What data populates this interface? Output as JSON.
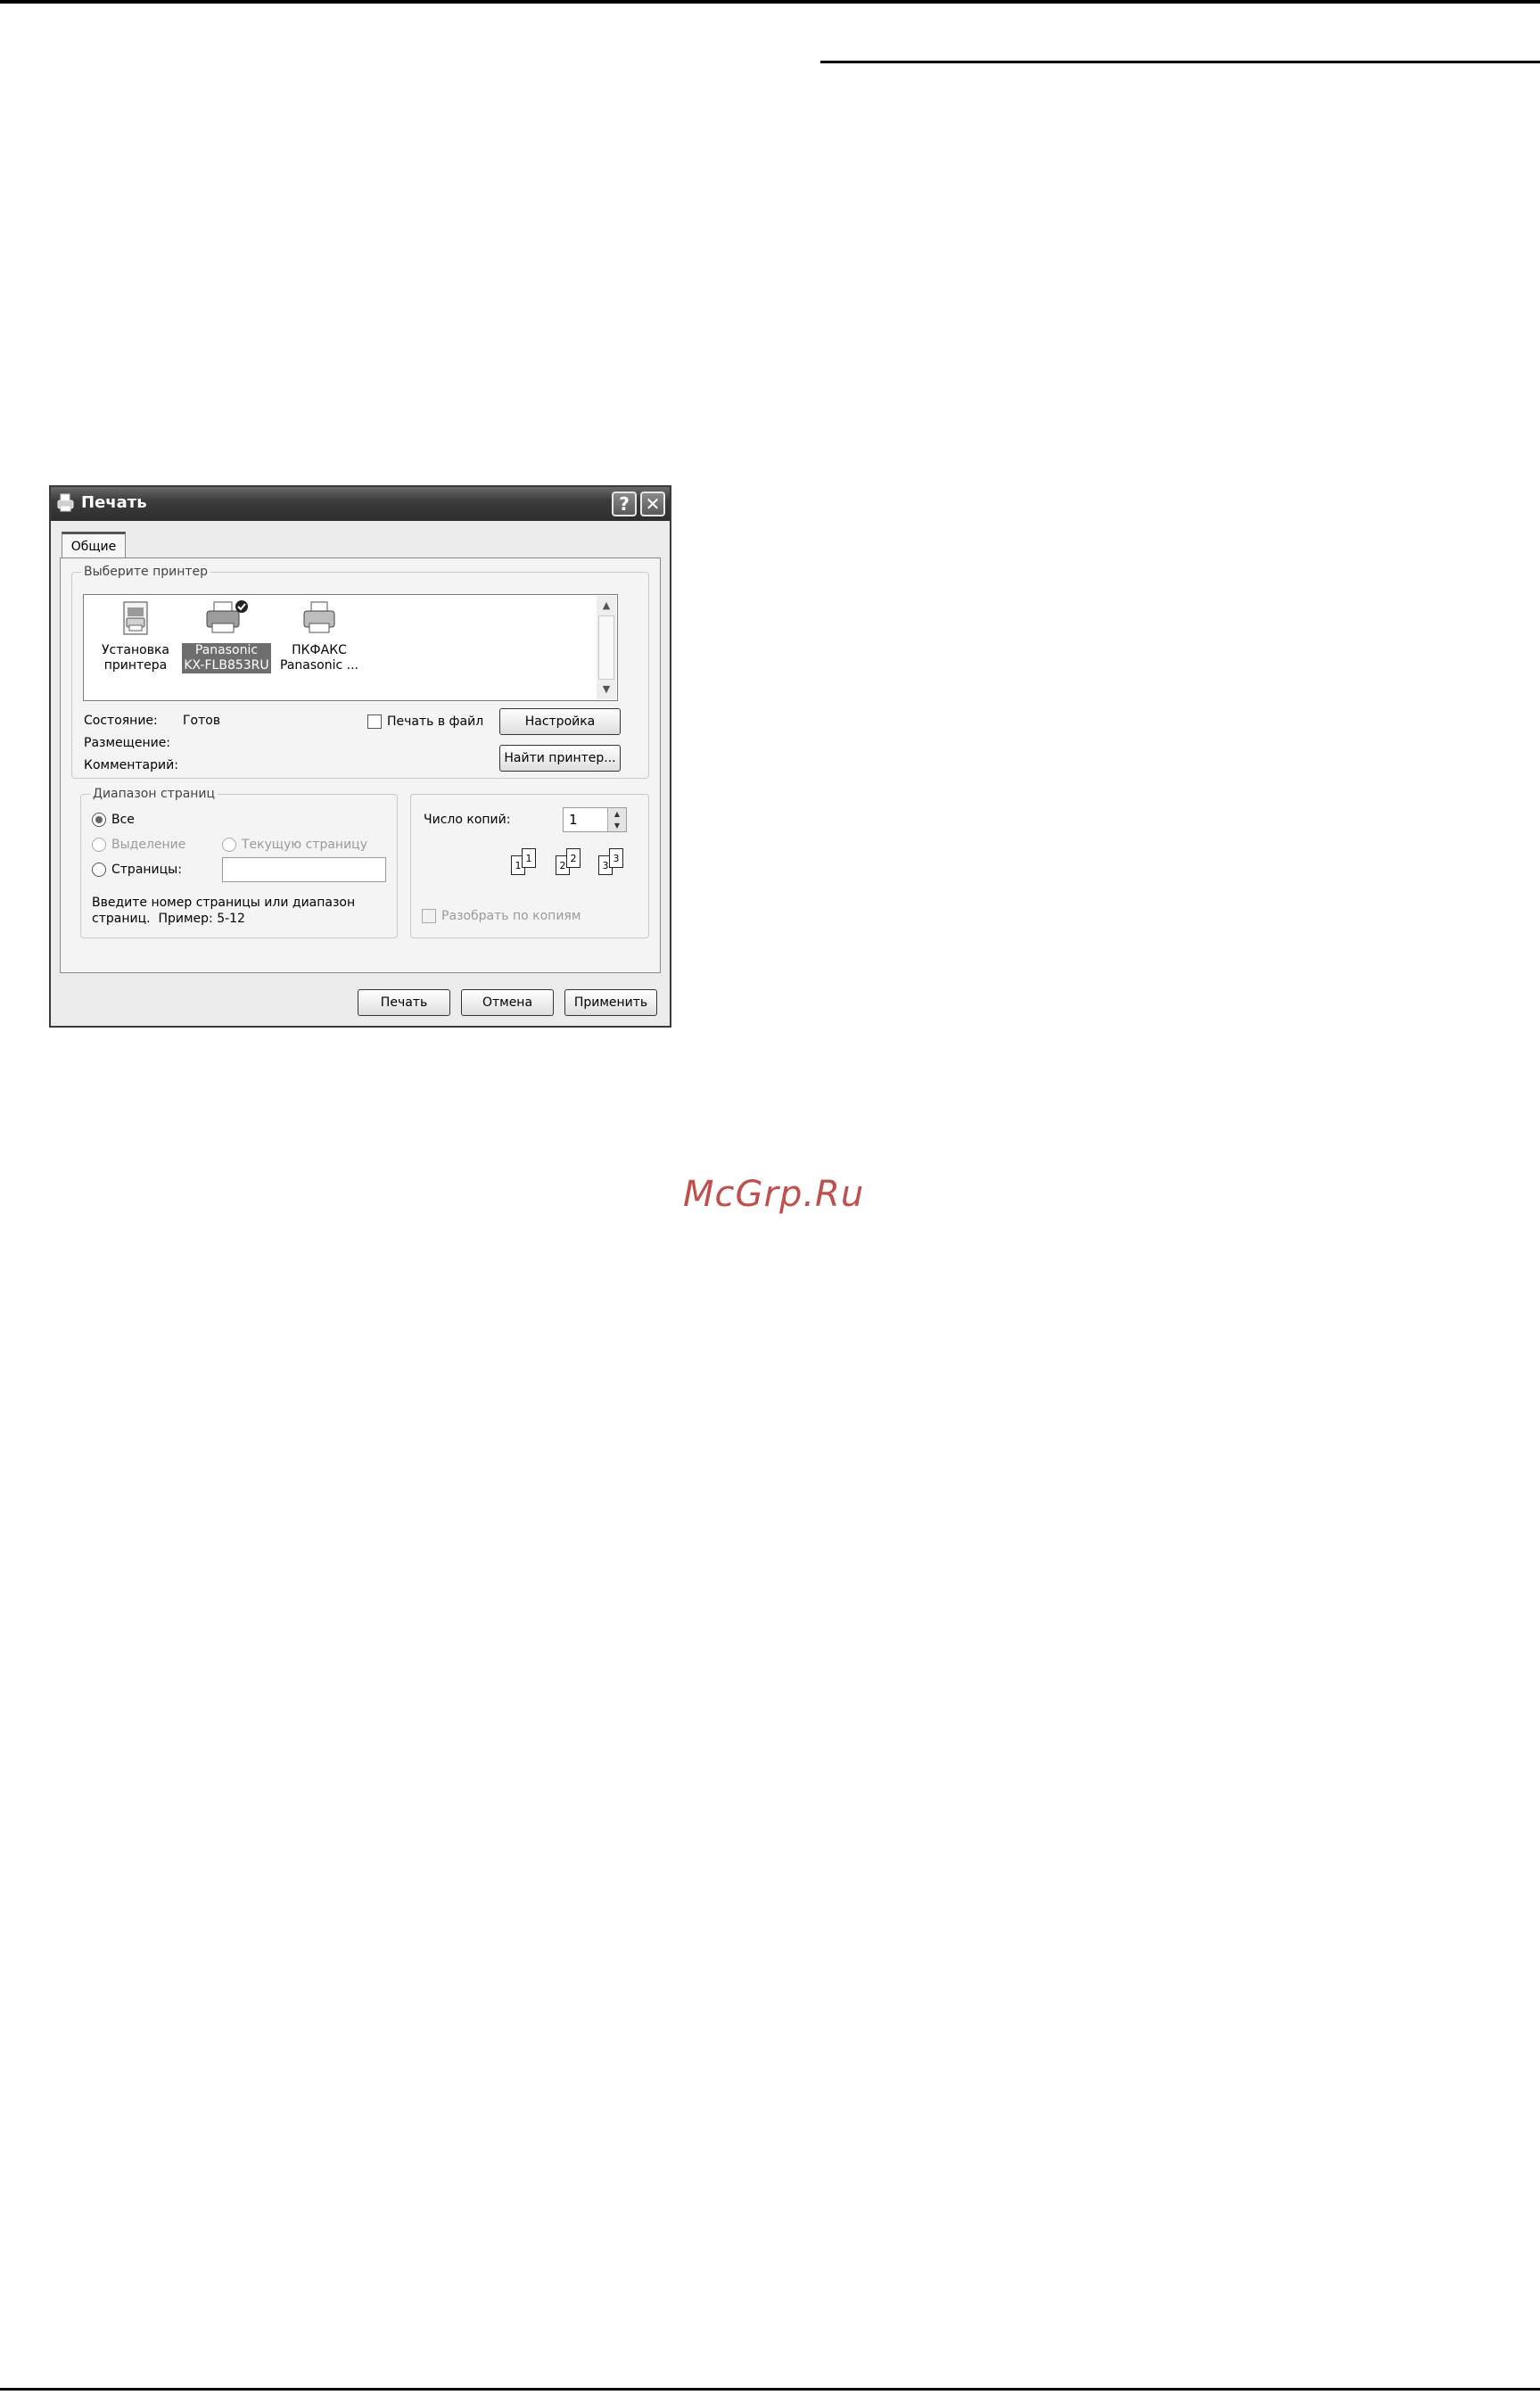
{
  "dialog": {
    "title": "Печать",
    "help_button": "?",
    "close_button": "✕"
  },
  "tab": {
    "label": "Общие"
  },
  "printer_group": {
    "label": "Выберите принтер",
    "printers": [
      {
        "label": "Установка\nпринтера",
        "icon": "add-printer-icon",
        "selected": false
      },
      {
        "label": "Panasonic\nKX-FLB853RU",
        "icon": "printer-icon",
        "selected": true
      },
      {
        "label": "ПКФАКС\nPanasonic ...",
        "icon": "printer-icon",
        "selected": false
      }
    ],
    "status_label": "Состояние:",
    "status_value": "Готов",
    "location_label": "Размещение:",
    "comment_label": "Комментарий:",
    "print_to_file_label": "Печать в файл",
    "settings_button": "Настройка",
    "find_printer_button": "Найти принтер..."
  },
  "page_range": {
    "label": "Диапазон страниц",
    "all_label": "Все",
    "selection_label": "Выделение",
    "current_page_label": "Текущую страницу",
    "pages_label": "Страницы:",
    "pages_value": "",
    "hint": "Введите номер страницы или диапазон\nстраниц.  Пример: 5-12",
    "selected": "all"
  },
  "copies": {
    "label": "Число копий:",
    "value": "1",
    "collate_label": "Разобрать по копиям",
    "page_numbers": [
      "1",
      "1",
      "2",
      "2",
      "3",
      "3"
    ]
  },
  "footer": {
    "print_button": "Печать",
    "cancel_button": "Отмена",
    "apply_button": "Применить"
  },
  "watermark": "McGrp.Ru",
  "colors": {
    "watermark": "#c0504d",
    "selection": "#6e6e6e"
  }
}
